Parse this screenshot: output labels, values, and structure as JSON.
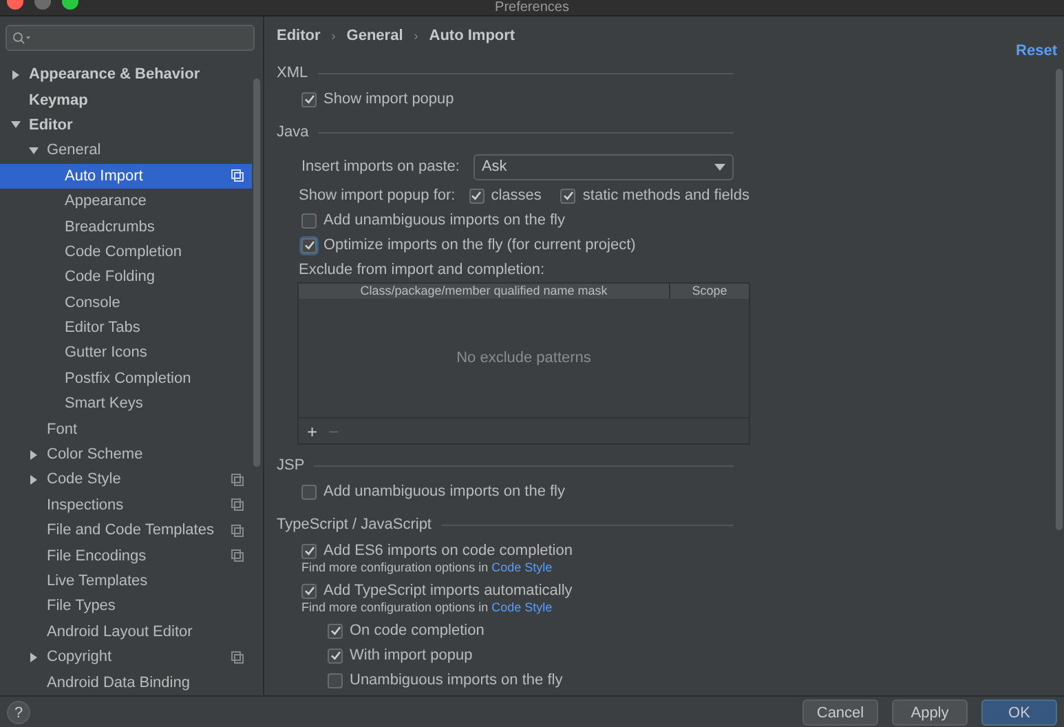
{
  "window": {
    "title": "Preferences"
  },
  "sidebar": {
    "tree": [
      {
        "label": "Appearance & Behavior",
        "expanded": false,
        "selected": false
      },
      {
        "label": "Keymap",
        "selected": false
      },
      {
        "label": "Editor",
        "expanded": true,
        "selected": false,
        "children": [
          {
            "label": "General",
            "expanded": true,
            "selected": false,
            "children": [
              {
                "label": "Auto Import",
                "selected": true,
                "project_scoped": true
              },
              {
                "label": "Appearance",
                "selected": false
              },
              {
                "label": "Breadcrumbs",
                "selected": false
              },
              {
                "label": "Code Completion",
                "selected": false
              },
              {
                "label": "Code Folding",
                "selected": false
              },
              {
                "label": "Console",
                "selected": false
              },
              {
                "label": "Editor Tabs",
                "selected": false
              },
              {
                "label": "Gutter Icons",
                "selected": false
              },
              {
                "label": "Postfix Completion",
                "selected": false
              },
              {
                "label": "Smart Keys",
                "selected": false
              }
            ]
          },
          {
            "label": "Font",
            "selected": false
          },
          {
            "label": "Color Scheme",
            "expanded": false,
            "selected": false
          },
          {
            "label": "Code Style",
            "expanded": false,
            "selected": false,
            "project_scoped": true
          },
          {
            "label": "Inspections",
            "selected": false,
            "project_scoped": true
          },
          {
            "label": "File and Code Templates",
            "selected": false,
            "project_scoped": true
          },
          {
            "label": "File Encodings",
            "selected": false,
            "project_scoped": true
          },
          {
            "label": "Live Templates",
            "selected": false
          },
          {
            "label": "File Types",
            "selected": false
          },
          {
            "label": "Android Layout Editor",
            "selected": false
          },
          {
            "label": "Copyright",
            "expanded": false,
            "selected": false,
            "project_scoped": true
          },
          {
            "label": "Android Data Binding",
            "selected": false
          }
        ]
      }
    ]
  },
  "breadcrumb": {
    "items": [
      "Editor",
      "General",
      "Auto Import"
    ],
    "separator": "›"
  },
  "reset_link": "Reset",
  "sections": [
    {
      "title": "XML",
      "items": [
        {
          "kind": "checkbox",
          "label": "Show import popup",
          "checked": true
        }
      ]
    },
    {
      "title": "Java",
      "items": [
        {
          "kind": "dropdown",
          "label": "Insert imports on paste:",
          "value": "Ask"
        },
        {
          "kind": "checkgroup",
          "label": "Show import popup for:",
          "options": [
            {
              "label": "classes",
              "checked": true
            },
            {
              "label": "static methods and fields",
              "checked": true
            }
          ]
        },
        {
          "kind": "checkbox",
          "label": "Add unambiguous imports on the fly",
          "checked": false
        },
        {
          "kind": "checkbox",
          "label": "Optimize imports on the fly (for current project)",
          "checked": true,
          "focused": true
        },
        {
          "kind": "table",
          "label": "Exclude from import and completion:",
          "columns": [
            "Class/package/member qualified name mask",
            "Scope"
          ],
          "empty_text": "No exclude patterns",
          "add": "+",
          "remove": "−"
        }
      ]
    },
    {
      "title": "JSP",
      "items": [
        {
          "kind": "checkbox",
          "label": "Add unambiguous imports on the fly",
          "checked": false
        }
      ]
    },
    {
      "title": "TypeScript / JavaScript",
      "items": [
        {
          "kind": "checkbox",
          "label": "Add ES6 imports on code completion",
          "checked": true,
          "hint": "Find more configuration options in",
          "link": "Code Style"
        },
        {
          "kind": "checkbox",
          "label": "Add TypeScript imports automatically",
          "checked": true,
          "hint": "Find more configuration options in",
          "link": "Code Style",
          "children": [
            {
              "kind": "checkbox",
              "label": "On code completion",
              "checked": true
            },
            {
              "kind": "checkbox",
              "label": "With import popup",
              "checked": true
            },
            {
              "kind": "checkbox",
              "label": "Unambiguous imports on the fly",
              "checked": false
            }
          ]
        }
      ]
    }
  ],
  "help": "?",
  "buttons": [
    {
      "label": "Cancel",
      "default": false
    },
    {
      "label": "Apply",
      "default": false
    },
    {
      "label": "OK",
      "default": true
    }
  ]
}
